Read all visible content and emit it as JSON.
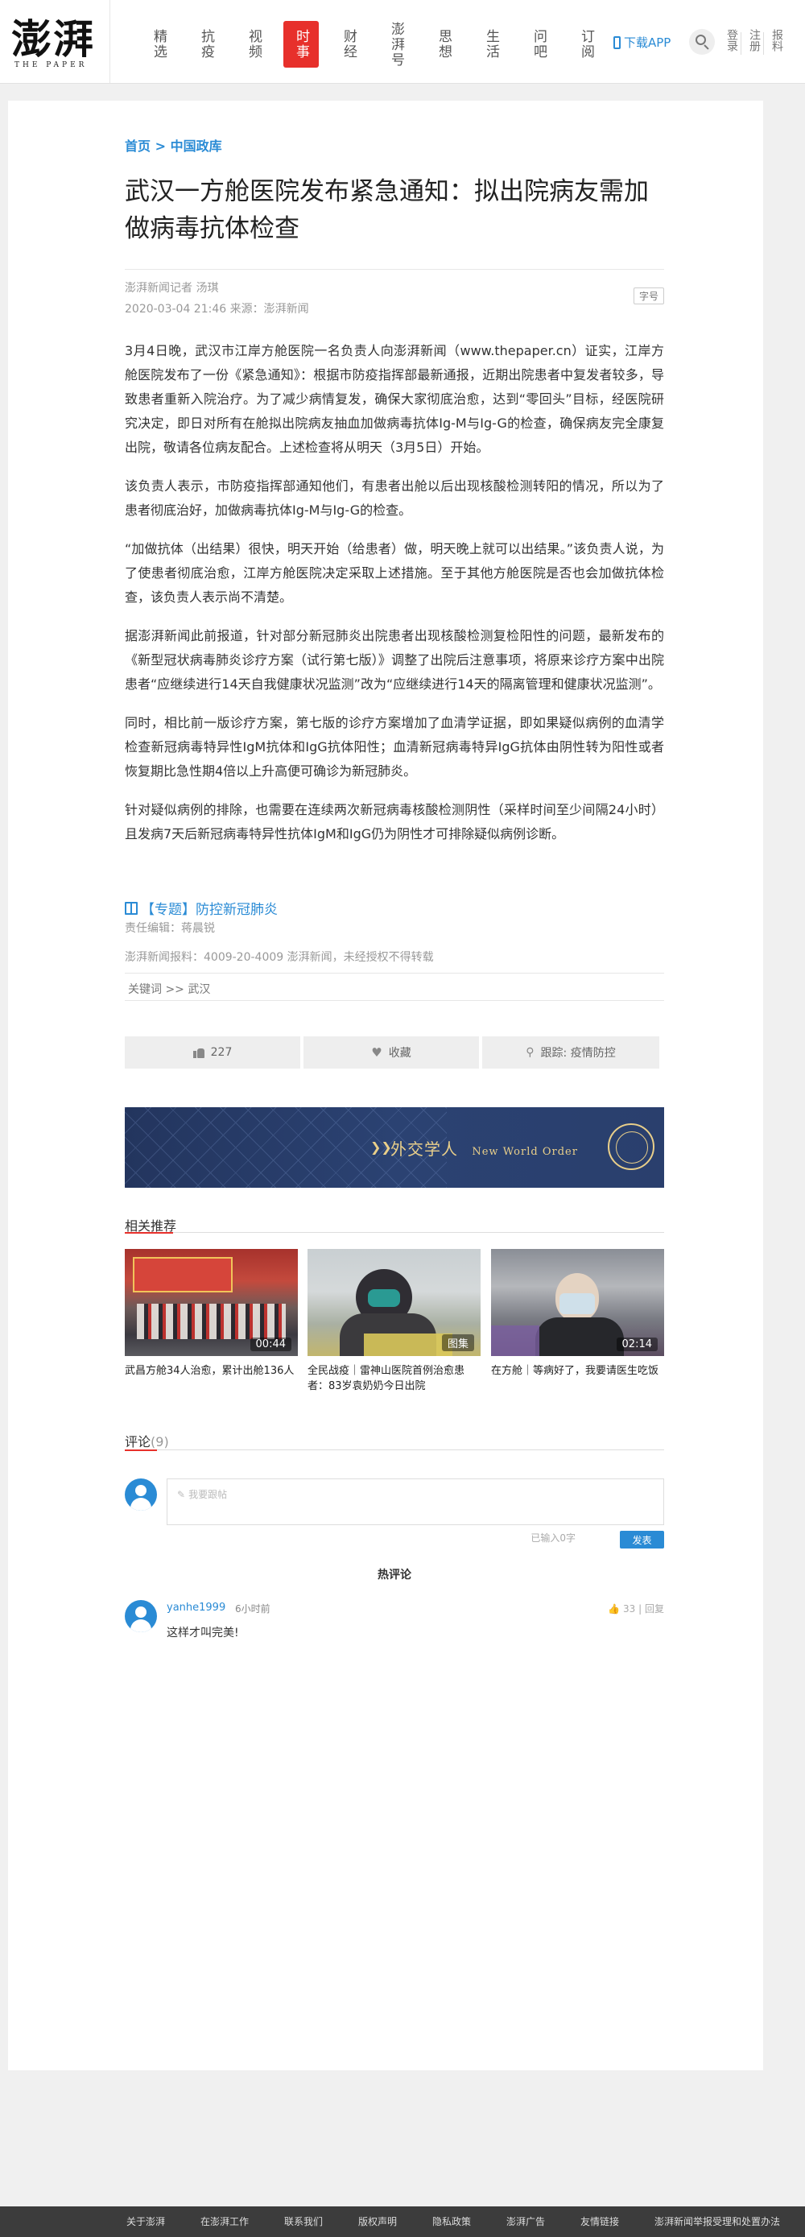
{
  "header": {
    "logo_text": "澎湃",
    "logo_sub": "THE PAPER",
    "nav": [
      "精选",
      "抗疫",
      "视频",
      "时事",
      "财经",
      "澎湃号",
      "思想",
      "生活",
      "问吧",
      "订阅"
    ],
    "download_app": "下载APP",
    "login": "登录",
    "register": "注册",
    "report": "报料"
  },
  "article": {
    "breadcrumb_home": "首页",
    "breadcrumb_sep": ">",
    "breadcrumb_section": "中国政库",
    "title": "武汉一方舱医院发布紧急通知：拟出院病友需加做病毒抗体检查",
    "author": "澎湃新闻记者 汤琪",
    "datetime_source": "2020-03-04 21:46 来源：澎湃新闻",
    "font_size_label": "字号",
    "paragraphs": [
      "3月4日晚，武汉市江岸方舱医院一名负责人向澎湃新闻（www.thepaper.cn）证实，江岸方舱医院发布了一份《紧急通知》：根据市防疫指挥部最新通报，近期出院患者中复发者较多，导致患者重新入院治疗。为了减少病情复发，确保大家彻底治愈，达到“零回头”目标，经医院研究决定，即日对所有在舱拟出院病友抽血加做病毒抗体Ig-M与Ig-G的检查，确保病友完全康复出院，敬请各位病友配合。上述检查将从明天（3月5日）开始。",
      "该负责人表示，市防疫指挥部通知他们，有患者出舱以后出现核酸检测转阳的情况，所以为了患者彻底治好，加做病毒抗体Ig-M与Ig-G的检查。",
      "“加做抗体（出结果）很快，明天开始（给患者）做，明天晚上就可以出结果。”该负责人说，为了使患者彻底治愈，江岸方舱医院决定采取上述措施。至于其他方舱医院是否也会加做抗体检查，该负责人表示尚不清楚。",
      "据澎湃新闻此前报道，针对部分新冠肺炎出院患者出现核酸检测复检阳性的问题，最新发布的《新型冠状病毒肺炎诊疗方案（试行第七版）》调整了出院后注意事项，将原来诊疗方案中出院患者“应继续进行14天自我健康状况监测”改为“应继续进行14天的隔离管理和健康状况监测”。",
      "同时，相比前一版诊疗方案，第七版的诊疗方案增加了血清学证据，即如果疑似病例的血清学检查新冠病毒特异性IgM抗体和IgG抗体阳性；血清新冠病毒特异IgG抗体由阴性转为阳性或者恢复期比急性期4倍以上升高便可确诊为新冠肺炎。",
      "针对疑似病例的排除，也需要在连续两次新冠病毒核酸检测阴性（采样时间至少间隔24小时）且发病7天后新冠病毒特异性抗体IgM和IgG仍为阴性才可排除疑似病例诊断。"
    ],
    "special_topic": "【专题】防控新冠肺炎",
    "editor": "责任编辑：蒋晨锐",
    "hotline": "澎湃新闻报料：4009-20-4009   澎湃新闻，未经授权不得转载",
    "keywords": "关键词 >> 武汉"
  },
  "actions": {
    "likes": "227",
    "favorite": "收藏",
    "follow": "跟踪: 疫情防控"
  },
  "banner": {
    "title": "外交学人",
    "subtitle": "New World Order"
  },
  "related": {
    "heading": "相关推荐",
    "items": [
      {
        "caption": "武昌方舱34人治愈，累计出舱136人",
        "badge": "00:44"
      },
      {
        "caption": "全民战疫｜雷神山医院首例治愈患者：83岁袁奶奶今日出院",
        "badge": "图集"
      },
      {
        "caption": "在方舱｜等病好了，我要请医生吃饭",
        "badge": "02:14"
      }
    ]
  },
  "comments": {
    "heading": "评论",
    "count": "(9)",
    "placeholder": "我要跟帖",
    "counter": "已输入0字",
    "publish": "发表",
    "hot_heading": "热评论",
    "items": [
      {
        "user": "yanhe1999",
        "time": "6小时前",
        "text": "这样才叫完美!",
        "likes": "33",
        "reply": "回复"
      }
    ]
  },
  "footer": [
    "关于澎湃",
    "在澎湃工作",
    "联系我们",
    "版权声明",
    "隐私政策",
    "澎湃广告",
    "友情链接",
    "澎湃新闻举报受理和处置办法"
  ],
  "colors": {
    "accent": "#2a8bd5",
    "active_nav": "#e7302b"
  }
}
